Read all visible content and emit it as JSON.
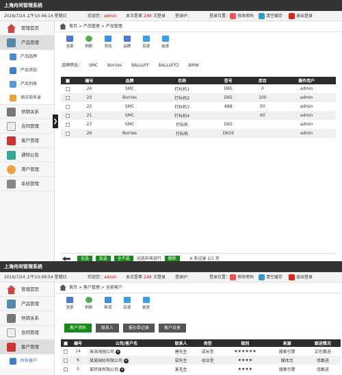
{
  "app_title": "上海舟同管理系统",
  "colors": {
    "dark_bar": "#333333",
    "active_green": "#178b17",
    "accent_red": "#dd0000"
  },
  "screen1": {
    "infobar": {
      "datetime": "2016/7/24 上午10:49:14 星期日",
      "welcome": "欢迎您：",
      "user": "admin",
      "login_prefix": "本次是第",
      "login_count": "249",
      "login_suffix": "次登录",
      "ip_label": "登录IP：",
      "location_label": "登录位置：",
      "change_pwd": "修改密码",
      "clear_cache": "清空缓存",
      "logout": "退出登录"
    },
    "sidebar": {
      "items": [
        {
          "label": "管理首页",
          "icon": "home-icon"
        },
        {
          "label": "产品管理",
          "icon": "product-icon"
        }
      ],
      "subitems": [
        {
          "label": "产品品牌",
          "icon": "brand-icon"
        },
        {
          "label": "产品添加",
          "icon": "add-icon"
        },
        {
          "label": "产品列表",
          "icon": "list-icon"
        },
        {
          "label": "供应商名录",
          "icon": "supplier-icon"
        }
      ],
      "items_after": [
        {
          "label": "供销关系",
          "icon": "relation-icon"
        },
        {
          "label": "合同管理",
          "icon": "contract-icon"
        },
        {
          "label": "客户管理",
          "icon": "customer-icon"
        },
        {
          "label": "通知公告",
          "icon": "notice-icon"
        },
        {
          "label": "用户管理",
          "icon": "user-icon"
        },
        {
          "label": "系统管理",
          "icon": "system-icon"
        }
      ]
    },
    "breadcrumb": [
      "首页",
      "产品管理",
      "产品管理"
    ],
    "toolbar": [
      "全部",
      "刷新",
      "添加",
      "品牌",
      "后退",
      "前进"
    ],
    "brand_filter": {
      "label": "品牌筛选：",
      "brands": [
        "SMC",
        "Borries",
        "BALLUFF",
        "BALLUFF2",
        "BMW"
      ]
    },
    "table": {
      "headers": [
        "编号",
        "品牌",
        "名称",
        "型号",
        "库存",
        "操作用户"
      ],
      "rows": [
        [
          "24",
          "SMC",
          "打标机1",
          "D65",
          "0",
          "admin"
        ],
        [
          "23",
          "Borries",
          "打标机2",
          "D65",
          "100",
          "admin"
        ],
        [
          "22",
          "SMC",
          "打标机3",
          "888",
          "50",
          "admin"
        ],
        [
          "21",
          "SMC",
          "打标机4",
          "",
          "60",
          "admin"
        ],
        [
          "27",
          "SMC",
          "打标机",
          "D65",
          "",
          "admin"
        ],
        [
          "26",
          "Borries",
          "打标机",
          "D659",
          "",
          "admin"
        ]
      ]
    },
    "footer": {
      "buttons": [
        "全选",
        "反选",
        "全不选"
      ],
      "action_text": "对选中项进行",
      "delete": "删除",
      "pagination": "6 条记录 1/1 页"
    }
  },
  "screen2": {
    "infobar": {
      "datetime": "2016/7/24 上午10:49:54 星期日",
      "welcome": "欢迎您：",
      "user": "admin",
      "login_prefix": "本次是第",
      "login_count": "249",
      "login_suffix": "次登录",
      "ip_label": "登录IP：",
      "location_label": "登录位置：",
      "change_pwd": "修改密码",
      "clear_cache": "清空缓存",
      "logout": "退出登录"
    },
    "sidebar": {
      "items": [
        {
          "label": "管理首页",
          "icon": "home-icon"
        },
        {
          "label": "产品管理",
          "icon": "product-icon"
        },
        {
          "label": "供销关系",
          "icon": "relation-icon"
        },
        {
          "label": "合同管理",
          "icon": "contract-icon"
        },
        {
          "label": "客户管理",
          "icon": "customer-icon"
        }
      ],
      "subitem": {
        "label": "所有客户",
        "icon": "all-customers-icon"
      }
    },
    "breadcrumb": [
      "首页",
      "客户管理",
      "全部客户"
    ],
    "toolbar": [
      "全部",
      "刷新",
      "新增",
      "后退",
      "前进"
    ],
    "tabs": [
      "客户资料",
      "联系人",
      "报价单记录",
      "客户共享"
    ],
    "table": {
      "headers": [
        "编号",
        "公司/客户名",
        "联系人",
        "类型",
        "级别",
        "来源",
        "跟进情况"
      ],
      "rows": [
        [
          "14",
          "珠海海园公司",
          "唐先生",
          "成长型",
          "★★★★★★",
          "搜索引擎",
          "正在跟进"
        ],
        [
          "6",
          "某某国际有限公司",
          "梁先生",
          "创业型",
          "★★★★",
          "媒体合",
          "待跟进"
        ],
        [
          "5",
          "某环球有限公司",
          "某先生",
          "",
          "★★★★",
          "搜索引擎",
          "待跟进"
        ]
      ]
    }
  }
}
